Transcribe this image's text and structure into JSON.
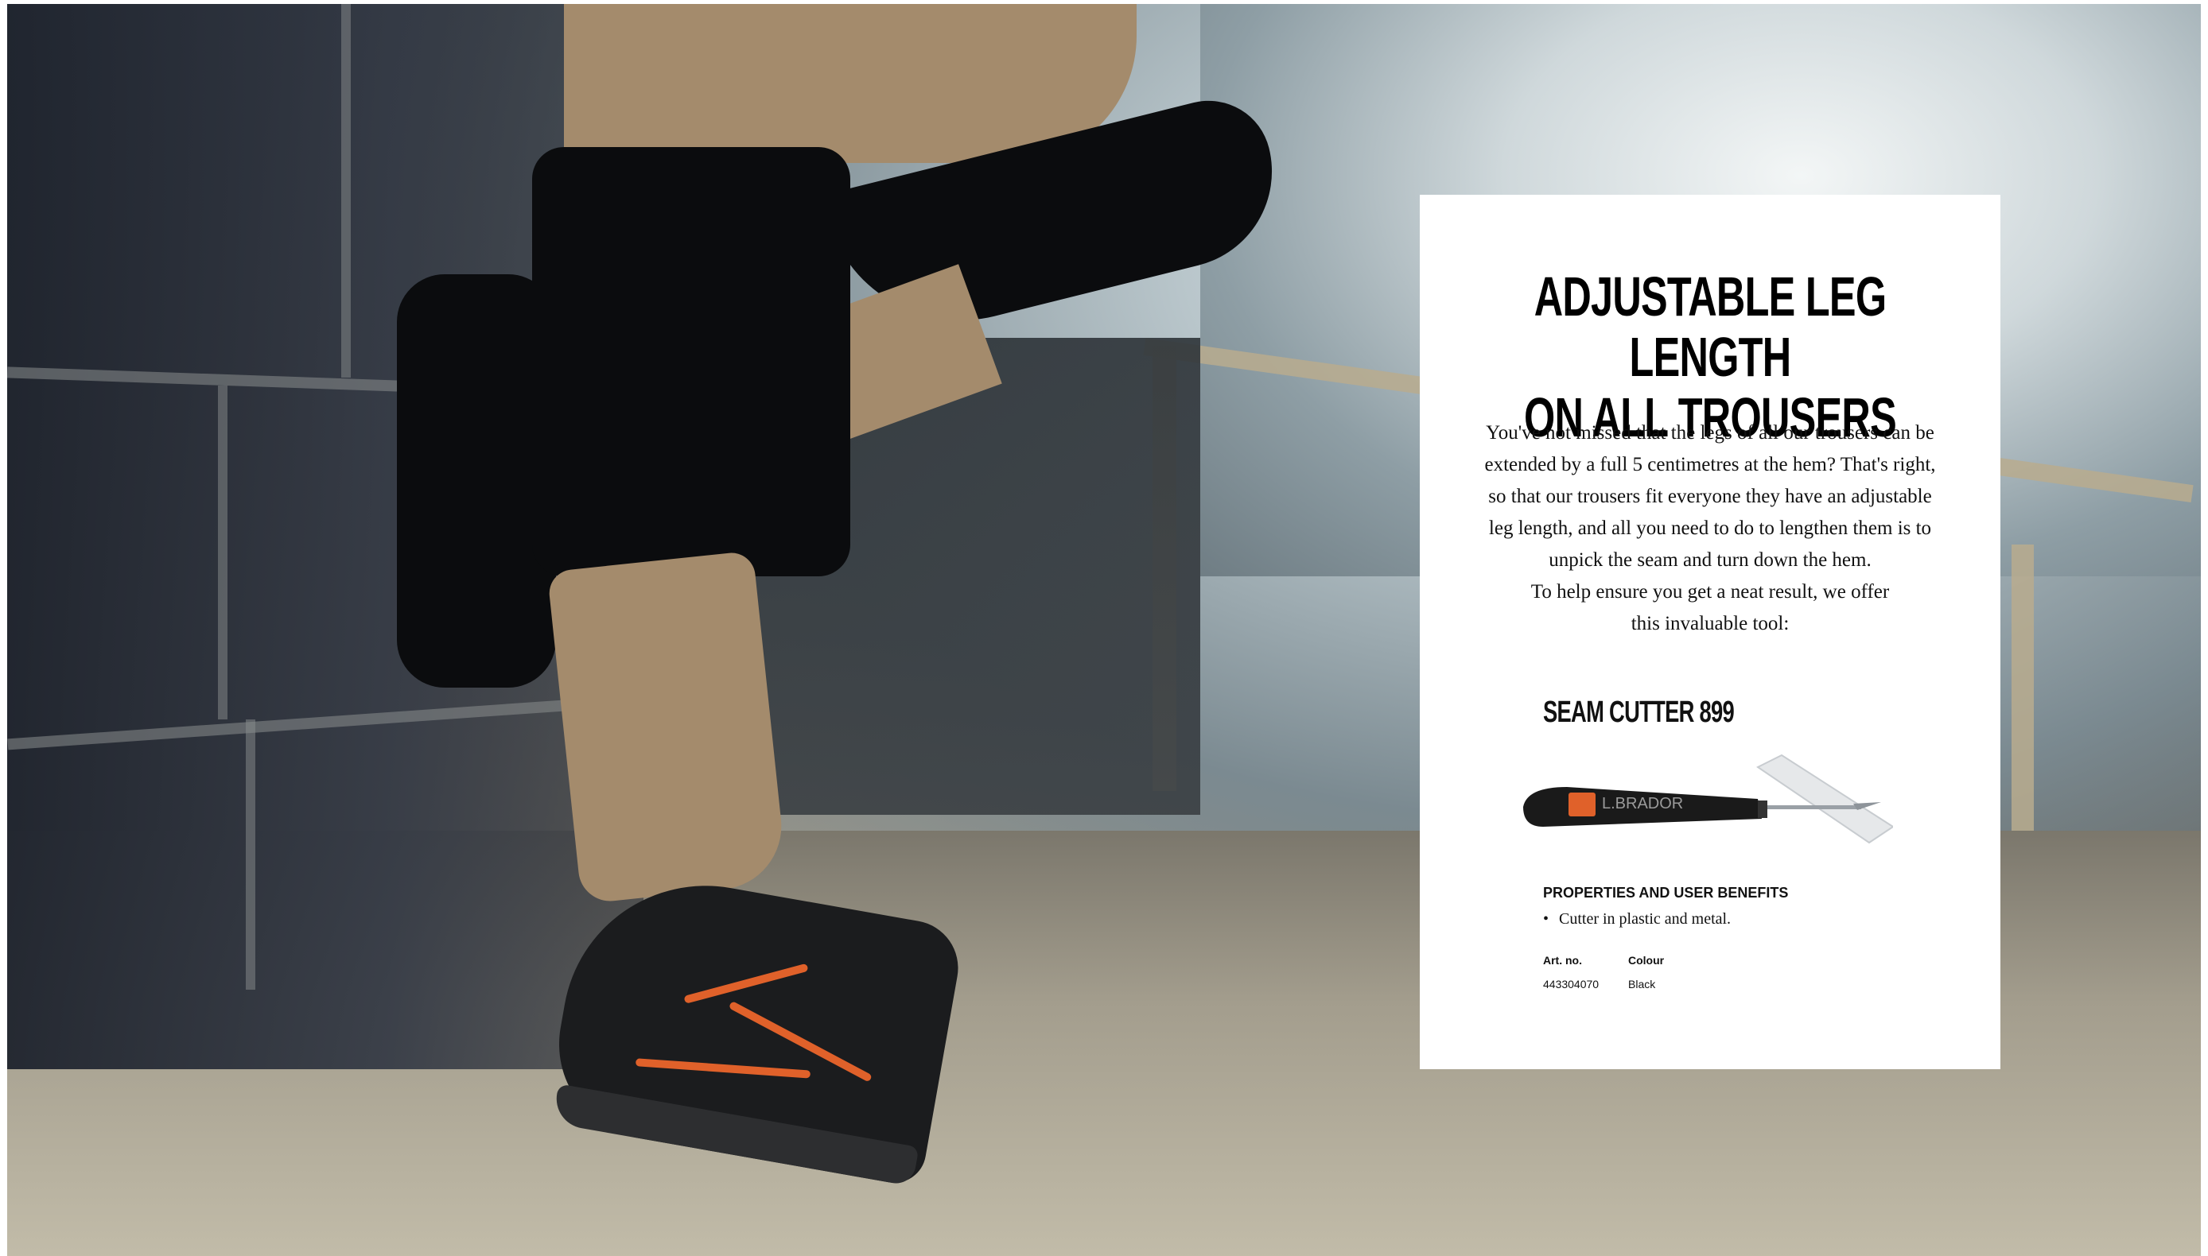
{
  "card": {
    "title_line1": "ADJUSTABLE LEG LENGTH",
    "title_line2": "ON ALL TROUSERS",
    "body": [
      "You've not missed that the legs of  all our trousers can be",
      "extended by a full 5 centimetres at the hem? That's right,",
      "so that our trousers fit everyone they have an adjustable",
      "leg length, and all you need to do to lengthen them is to",
      "unpick the seam and turn down the hem.",
      "To help ensure you get a neat result, we offer",
      "this invaluable tool:"
    ]
  },
  "product": {
    "name": "SEAM CUTTER 899",
    "brand_logo": "L.BRADOR",
    "properties_heading": "PROPERTIES AND USER BENEFITS",
    "properties": [
      "Cutter in plastic and metal."
    ],
    "art_no_label": "Art. no.",
    "art_no_value": "443304070",
    "colour_label": "Colour",
    "colour_value": "Black"
  },
  "colors": {
    "card_background": "#ffffff",
    "text": "#111111",
    "accent_orange": "#e0612a"
  },
  "icons": {
    "tool": "seam-cutter-image"
  }
}
